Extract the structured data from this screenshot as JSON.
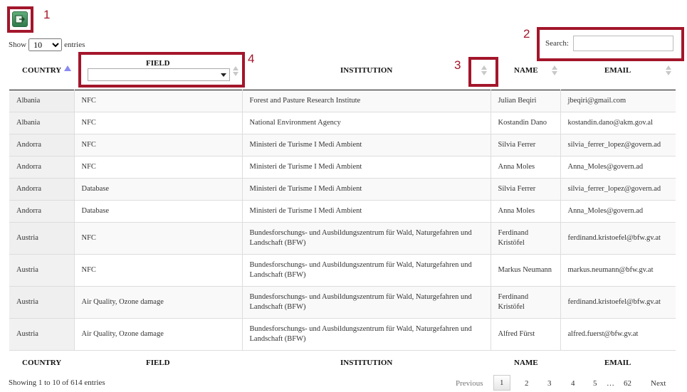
{
  "markers": {
    "m1": "1",
    "m2": "2",
    "m3": "3",
    "m4": "4"
  },
  "toolbar": {
    "export_icon": "export-icon"
  },
  "length": {
    "show_label": "Show",
    "value": "10",
    "entries_label": "entries"
  },
  "search": {
    "label": "Search:",
    "value": ""
  },
  "columns": {
    "country": "COUNTRY",
    "field": "FIELD",
    "institution": "INSTITUTION",
    "name": "NAME",
    "email": "EMAIL"
  },
  "field_filter": {
    "value": ""
  },
  "rows": [
    {
      "country": "Albania",
      "field": "NFC",
      "institution": "Forest and Pasture Research Institute",
      "name": "Julian Beqiri",
      "email": "jbeqiri@gmail.com"
    },
    {
      "country": "Albania",
      "field": "NFC",
      "institution": "National Environment Agency",
      "name": "Kostandin Dano",
      "email": "kostandin.dano@akm.gov.al"
    },
    {
      "country": "Andorra",
      "field": "NFC",
      "institution": "Ministeri de Turisme I Medi Ambient",
      "name": "Silvia Ferrer",
      "email": "silvia_ferrer_lopez@govern.ad"
    },
    {
      "country": "Andorra",
      "field": "NFC",
      "institution": "Ministeri de Turisme I Medi Ambient",
      "name": "Anna Moles",
      "email": "Anna_Moles@govern.ad"
    },
    {
      "country": "Andorra",
      "field": "Database",
      "institution": "Ministeri de Turisme I Medi Ambient",
      "name": "Silvia Ferrer",
      "email": "silvia_ferrer_lopez@govern.ad"
    },
    {
      "country": "Andorra",
      "field": "Database",
      "institution": "Ministeri de Turisme I Medi Ambient",
      "name": "Anna Moles",
      "email": "Anna_Moles@govern.ad"
    },
    {
      "country": "Austria",
      "field": "NFC",
      "institution": "Bundesforschungs- und Ausbildungszentrum für Wald, Naturgefahren und Landschaft (BFW)",
      "name": "Ferdinand Kristöfel",
      "email": "ferdinand.kristoefel@bfw.gv.at"
    },
    {
      "country": "Austria",
      "field": "NFC",
      "institution": "Bundesforschungs- und Ausbildungszentrum für Wald, Naturgefahren und Landschaft (BFW)",
      "name": "Markus Neumann",
      "email": "markus.neumann@bfw.gv.at"
    },
    {
      "country": "Austria",
      "field": "Air Quality, Ozone damage",
      "institution": "Bundesforschungs- und Ausbildungszentrum für Wald, Naturgefahren und Landschaft (BFW)",
      "name": "Ferdinand Kristöfel",
      "email": "ferdinand.kristoefel@bfw.gv.at"
    },
    {
      "country": "Austria",
      "field": "Air Quality, Ozone damage",
      "institution": "Bundesforschungs- und Ausbildungszentrum für Wald, Naturgefahren und Landschaft (BFW)",
      "name": "Alfred Fürst",
      "email": "alfred.fuerst@bfw.gv.at"
    }
  ],
  "info": "Showing 1 to 10 of 614 entries",
  "pagination": {
    "previous": "Previous",
    "pages": [
      "1",
      "2",
      "3",
      "4",
      "5"
    ],
    "ellipsis": "…",
    "last": "62",
    "next": "Next",
    "current": "1"
  },
  "colors": {
    "marker": "#a3162b",
    "sort_active": "#8a8af0",
    "sort_inactive": "#c8c8c8"
  }
}
